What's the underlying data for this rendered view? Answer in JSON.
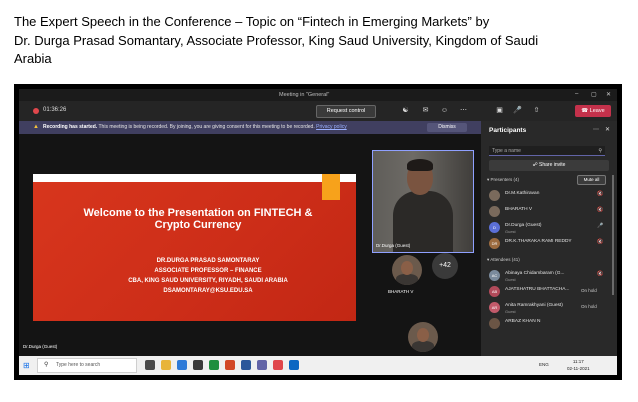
{
  "caption": {
    "line1": "The Expert Speech in the Conference – Topic on “Fintech in Emerging Markets” by",
    "line2": "Dr. Durga Prasad Somantary, Associate Professor, King Saud University, Kingdom of Saudi",
    "line3": "Arabia"
  },
  "window": {
    "title": "Meeting in \"General\"",
    "minimize": "–",
    "maximize": "▢",
    "close": "✕"
  },
  "toolbar": {
    "timer": "01:36:26",
    "request_control": "Request control",
    "leave": "Leave",
    "icons": [
      "people-icon",
      "chat-icon",
      "reactions-icon",
      "more-icon",
      "camera-icon",
      "mic-icon",
      "share-icon"
    ]
  },
  "banner": {
    "title": "Recording has started.",
    "text": "This meeting is being recorded. By joining, you are giving consent for this meeting to be recorded.",
    "link": "Privacy policy",
    "dismiss": "Dismiss"
  },
  "slide": {
    "heading_line1": "Welcome to the Presentation on FINTECH &",
    "heading_line2": "Crypto Currency",
    "name": "DR.DURGA PRASAD SAMONTARAY",
    "role": "ASSOCIATE PROFESSOR – FINANCE",
    "org": "CBA, KING SAUD UNIVERSITY, RIYADH, SAUDI ARABIA",
    "email": "DSAMONTARAY@KSU.EDU.SA"
  },
  "stage": {
    "presenter_label": "Dr.Durga (Guest)",
    "speaker_label": "Dr.Durga (Guest)",
    "tile_label": "BHARATH V",
    "more_count": "+42"
  },
  "panel": {
    "title": "Participants",
    "search_placeholder": "Type a name",
    "share_invite": "Share invite",
    "presenters_header": "Presenters (4)",
    "mute_all": "Mute all",
    "presenters": [
      {
        "name": "Dr.M.Kathiravan",
        "initials": "",
        "guest": ""
      },
      {
        "name": "BHARATH V",
        "initials": "",
        "guest": ""
      },
      {
        "name": "Dr.Durga (Guest)",
        "initials": "D",
        "guest": "Guest"
      },
      {
        "name": "DR.K.THARAKA RAMI REDDY",
        "initials": "DR",
        "guest": ""
      }
    ],
    "attendees_header": "Attendees (41)",
    "attendees": [
      {
        "name": "Abinaya Chidambaram (G...",
        "initials": "AC",
        "guest": "Guest",
        "status": ""
      },
      {
        "name": "AJATSHATRU BHATTACHA...",
        "initials": "AB",
        "guest": "",
        "status": "On hold"
      },
      {
        "name": "Anita Ramrakhyani (Guest)",
        "initials": "AR",
        "guest": "Guest",
        "status": "On hold"
      },
      {
        "name": "ARBAZ KHAN N",
        "initials": "",
        "guest": "",
        "status": ""
      }
    ]
  },
  "taskbar": {
    "search_placeholder": "Type here to search",
    "time": "11:17",
    "date": "02-11-2021",
    "lang": "ENG"
  },
  "colors": {
    "slide_red": "#d4321b",
    "leave_red": "#c4314b",
    "teams_purple": "#6264a7",
    "accent_orange": "#f7a21b"
  }
}
